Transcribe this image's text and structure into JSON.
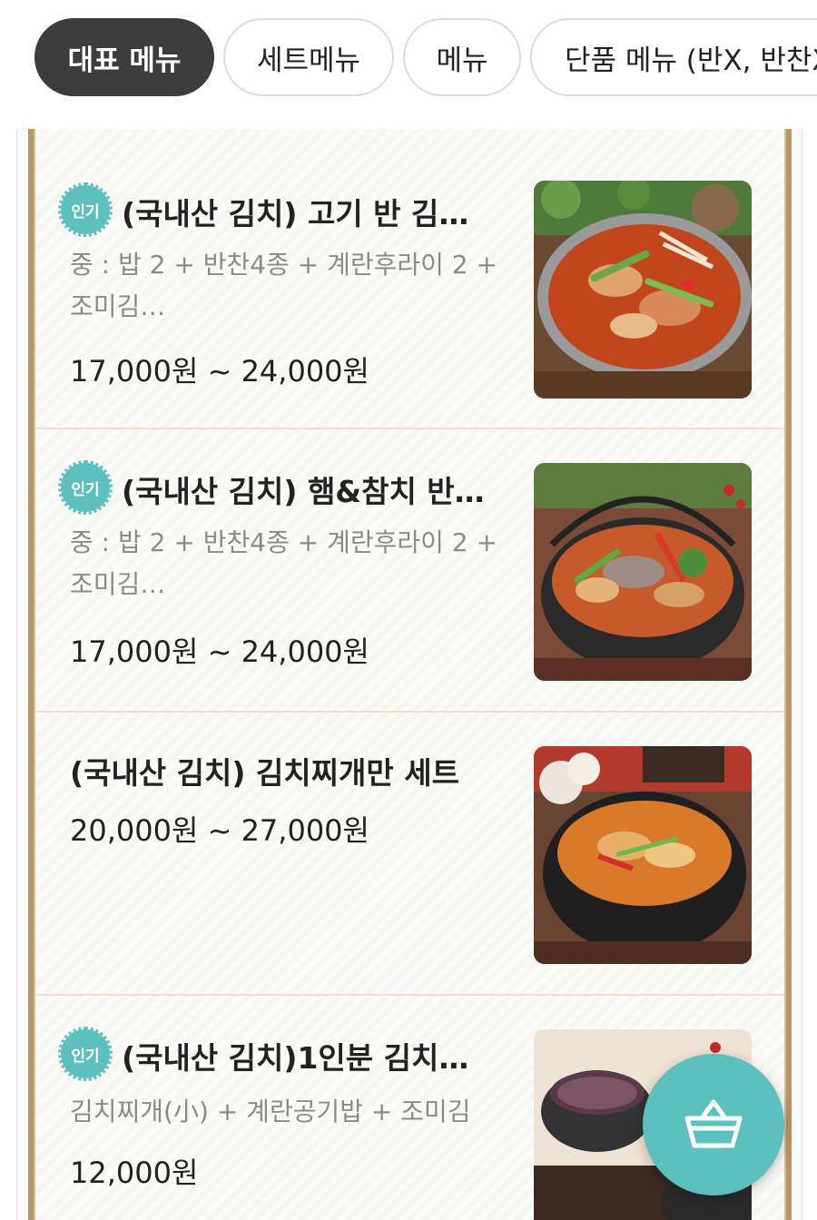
{
  "tabs": [
    {
      "label": "대표 메뉴",
      "active": true
    },
    {
      "label": "세트메뉴",
      "active": false
    },
    {
      "label": "메뉴",
      "active": false
    },
    {
      "label": "단품 메뉴 (반X, 반찬X)",
      "active": false
    }
  ],
  "menu": {
    "badge_label": "인기",
    "items": [
      {
        "name": "(국내산 김치) 고기 반 김…",
        "description": "중 : 밥 2 + 반찬4종 + 계란후라이 2 + 조미김…",
        "price": "17,000원 ~ 24,000원",
        "popular": true,
        "image": "pork-kimchi-stew-pot"
      },
      {
        "name": "(국내산 김치) 햄&참치 반…",
        "description": "중 : 밥 2 + 반찬4종 + 계란후라이 2 + 조미김…",
        "price": "17,000원 ~ 24,000원",
        "popular": true,
        "image": "ham-tuna-kimchi-stew-pot"
      },
      {
        "name": "(국내산 김치) 김치찌개만 세트",
        "description": "",
        "price": "20,000원 ~ 27,000원",
        "popular": false,
        "image": "kimchi-stew-stone-pot"
      },
      {
        "name": "(국내산 김치)1인분 김치…",
        "description": "김치찌개(小) + 계란공기밥 + 조미김",
        "price": "12,000원",
        "popular": true,
        "image": "single-serving-set"
      }
    ]
  },
  "cart": {
    "icon": "basket-icon"
  },
  "colors": {
    "accent": "#5bc0be",
    "active_tab": "#3d3d3d",
    "rail": "#b89566",
    "desc_text": "#8a8a8a"
  }
}
